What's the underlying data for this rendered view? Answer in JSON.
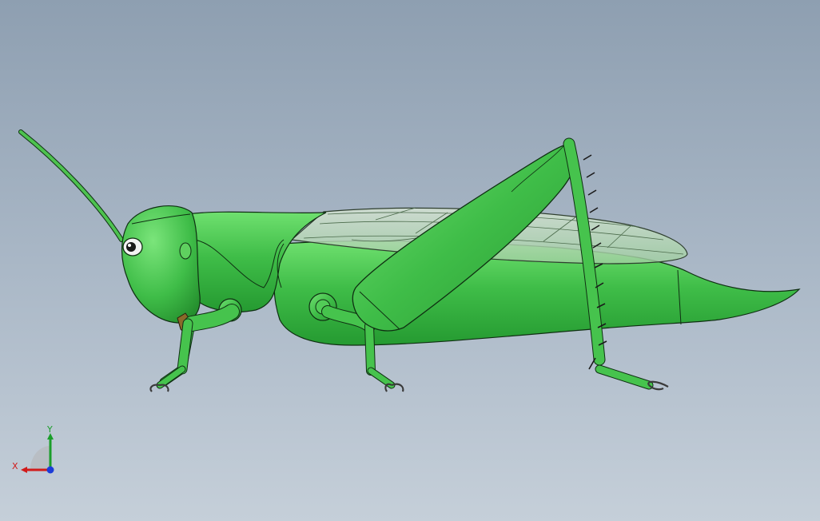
{
  "viewport": {
    "model_name": "grasshopper",
    "colors": {
      "body": "#3fbd48",
      "body_light": "#6fe06f",
      "body_dark": "#228a2c",
      "outline": "#0f2f12",
      "wing": "#c4d8c4",
      "claw": "#3a3a3a",
      "background_top": "#8e9fb1",
      "background_bottom": "#c5cfd9"
    }
  },
  "triad": {
    "x_label": "X",
    "y_label": "Y",
    "x_color": "#d11b1b",
    "y_color": "#1a9e2a",
    "z_color": "#1c3cd8"
  }
}
